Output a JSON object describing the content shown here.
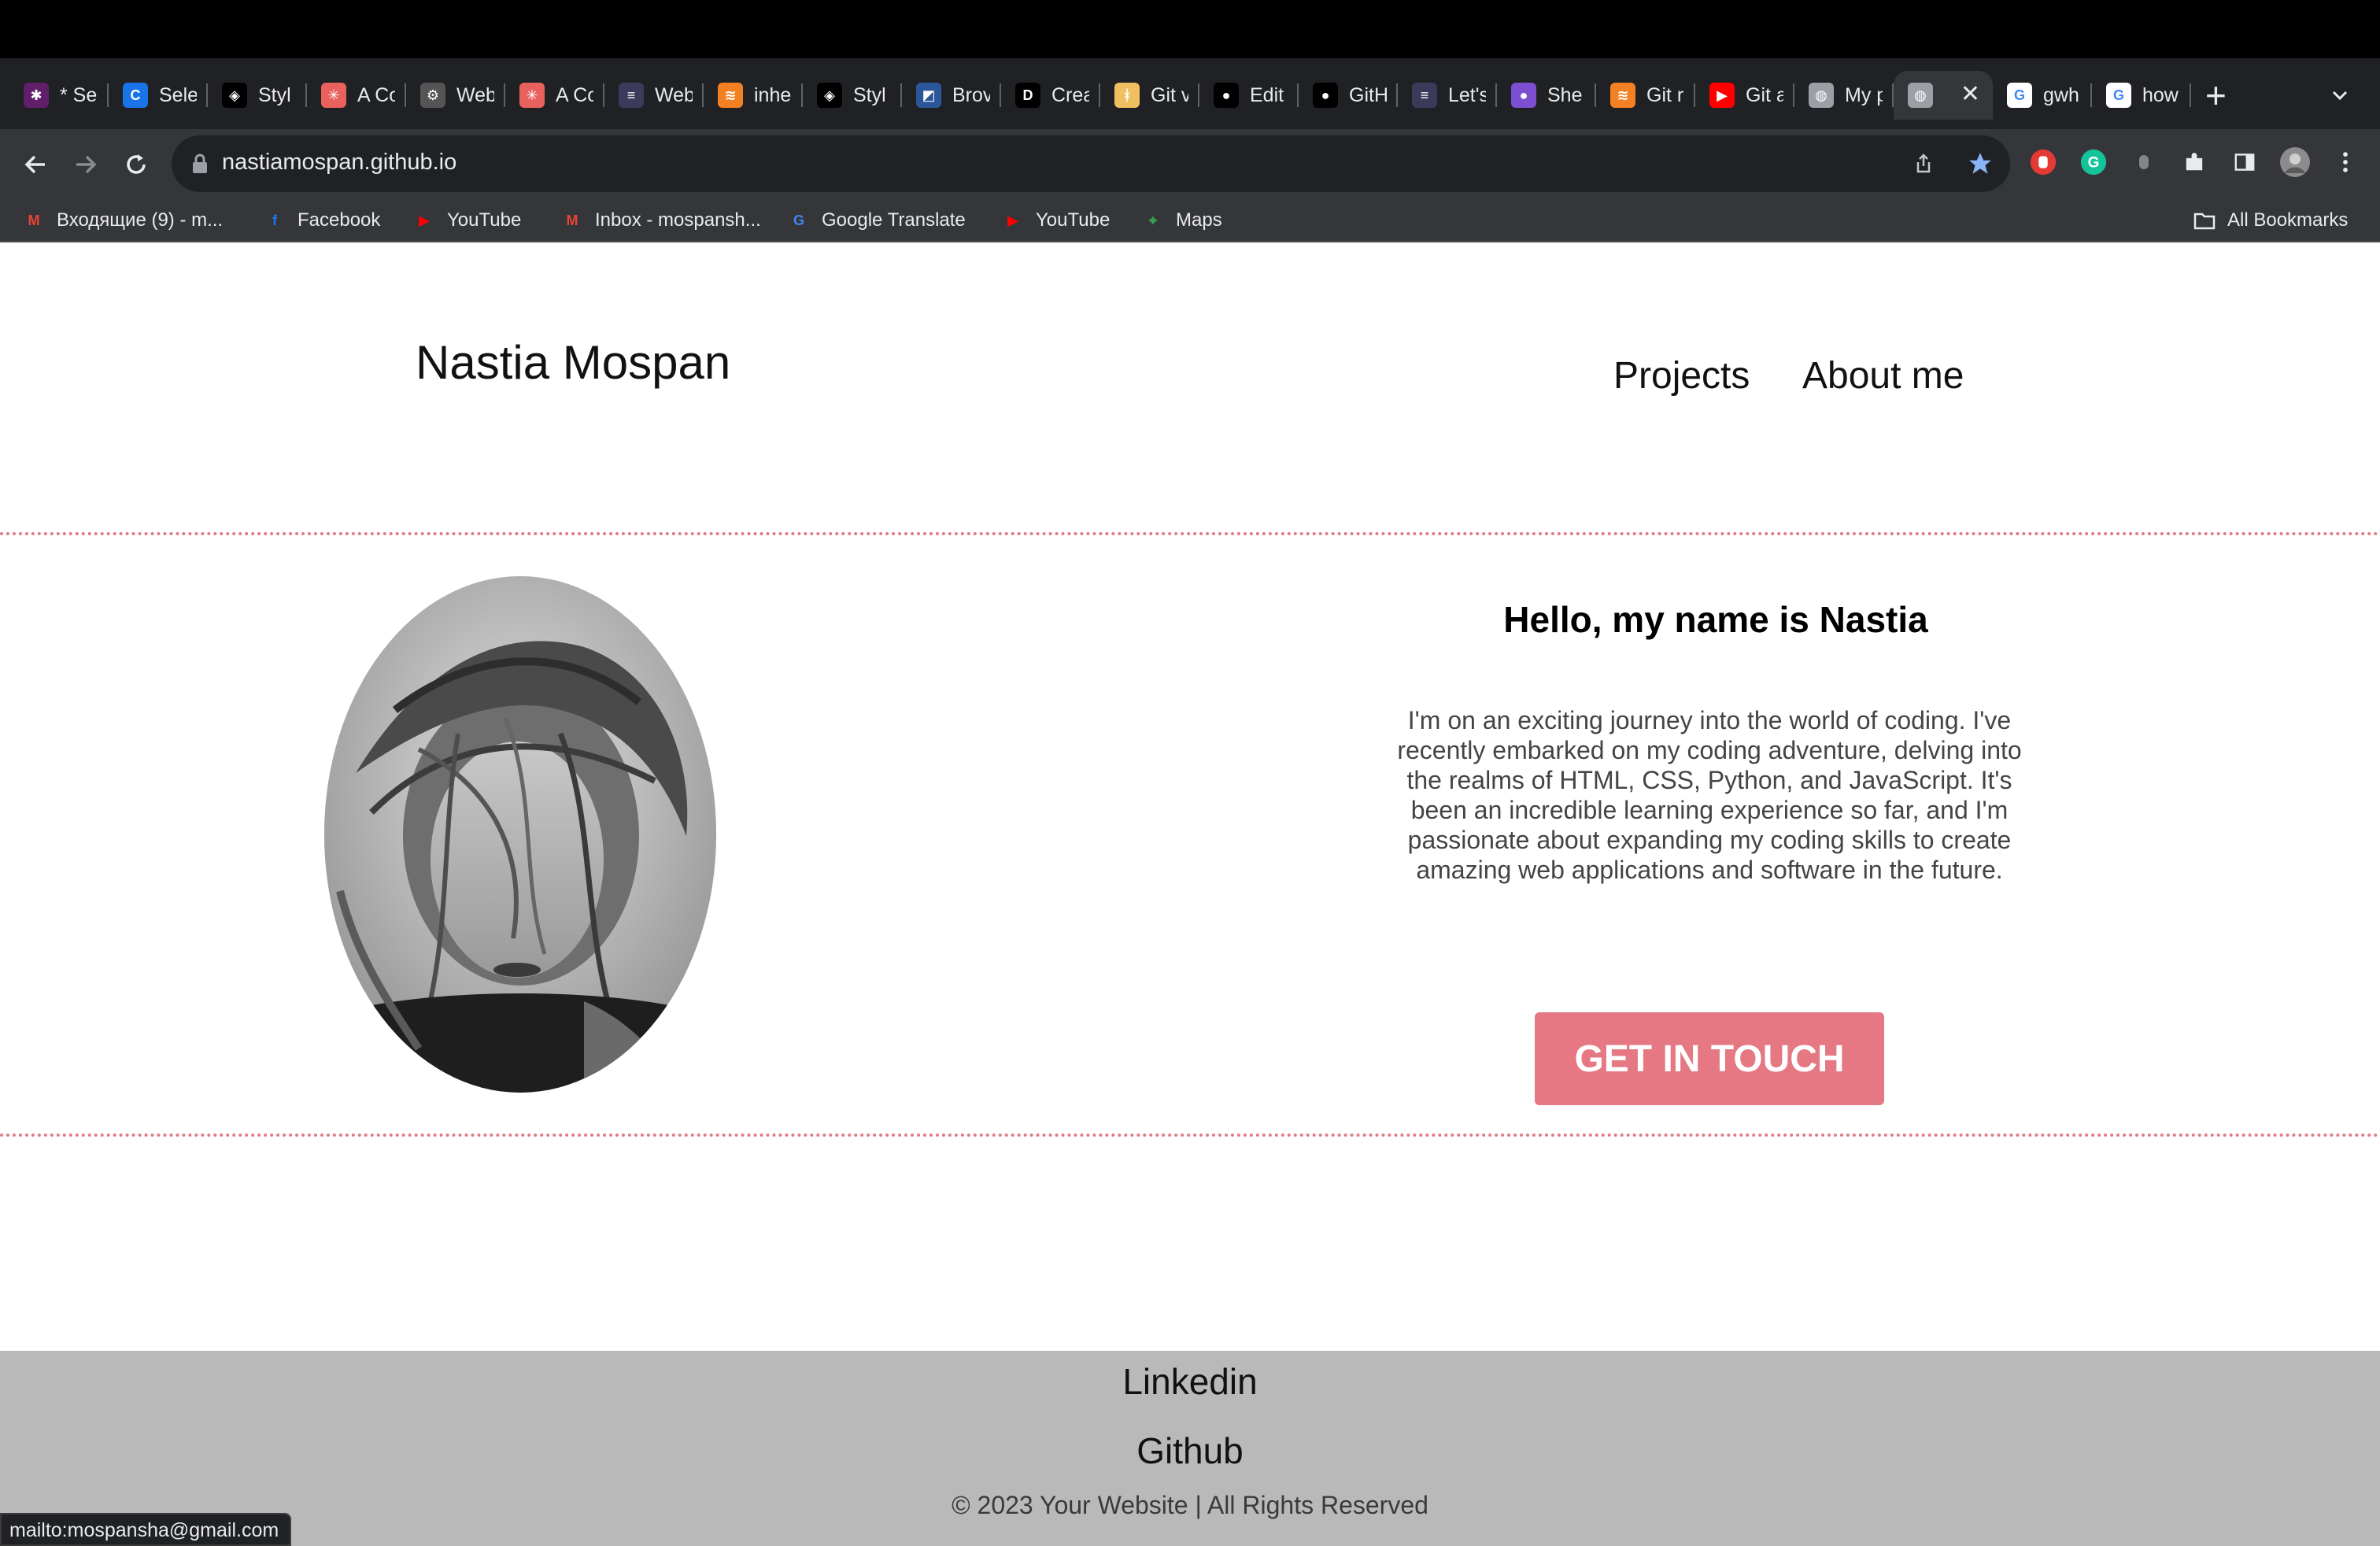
{
  "browser": {
    "tabs": [
      {
        "label": "* Se",
        "icon": "slack-icon",
        "color": "#611f69"
      },
      {
        "label": "Sele",
        "icon": "circle-c-icon",
        "color": "#1a73e8"
      },
      {
        "label": "Styl",
        "icon": "codepen-icon",
        "color": "#000000"
      },
      {
        "label": "A Co",
        "icon": "asterisk-icon",
        "color": "#e8615d"
      },
      {
        "label": "Web",
        "icon": "gear-icon",
        "color": "#555555"
      },
      {
        "label": "A Co",
        "icon": "asterisk-icon",
        "color": "#e8615d"
      },
      {
        "label": "Web",
        "icon": "bars-icon",
        "color": "#3a3a5a"
      },
      {
        "label": "inhe",
        "icon": "stackoverflow-icon",
        "color": "#f48024"
      },
      {
        "label": "Styl",
        "icon": "codepen-icon",
        "color": "#000000"
      },
      {
        "label": "Brov",
        "icon": "caniuse-icon",
        "color": "#2b579a"
      },
      {
        "label": "Crea",
        "icon": "dev-icon",
        "color": "#000000"
      },
      {
        "label": "Git v",
        "icon": "git-branch-icon",
        "color": "#f0c060"
      },
      {
        "label": "Edit",
        "icon": "github-icon",
        "color": "#000000"
      },
      {
        "label": "GitH",
        "icon": "github-icon",
        "color": "#000000"
      },
      {
        "label": "Let's",
        "icon": "bars-icon",
        "color": "#3a3a5a"
      },
      {
        "label": "She",
        "icon": "circle-purple-icon",
        "color": "#7b4fcf"
      },
      {
        "label": "Git r",
        "icon": "stackoverflow-icon",
        "color": "#f48024"
      },
      {
        "label": "Git a",
        "icon": "youtube-icon",
        "color": "#ff0000"
      },
      {
        "label": "My p",
        "icon": "globe-icon",
        "color": "#9aa0a6"
      },
      {
        "label": "",
        "icon": "globe-icon",
        "color": "#9aa0a6",
        "active": true
      },
      {
        "label": "gwh",
        "icon": "google-icon",
        "color": "#ffffff"
      },
      {
        "label": "how",
        "icon": "google-icon",
        "color": "#ffffff"
      }
    ],
    "url": "nastiamospan.github.io",
    "bookmarks": [
      {
        "label": "Входящие (9) - m...",
        "icon": "gmail-icon",
        "color": "#ea4335"
      },
      {
        "label": "Facebook",
        "icon": "facebook-icon",
        "color": "#1877f2"
      },
      {
        "label": "YouTube",
        "icon": "youtube-icon",
        "color": "#ff0000"
      },
      {
        "label": "Inbox - mospansh...",
        "icon": "gmail-icon",
        "color": "#ea4335"
      },
      {
        "label": "Google Translate",
        "icon": "translate-icon",
        "color": "#4285f4"
      },
      {
        "label": "YouTube",
        "icon": "youtube-icon",
        "color": "#ff0000"
      },
      {
        "label": "Maps",
        "icon": "maps-icon",
        "color": "#34a853"
      }
    ],
    "all_bookmarks_label": "All Bookmarks",
    "status_text": "mailto:mospansha@gmail.com"
  },
  "site": {
    "name": "Nastia Mospan",
    "nav": {
      "projects": "Projects",
      "about": "About me"
    },
    "hero": {
      "heading": "Hello, my name is Nastia",
      "intro": "I'm on an exciting journey into the world of coding. I've recently embarked on my coding adventure, delving into the realms of HTML, CSS, Python, and JavaScript. It's been an incredible learning experience so far, and I'm passionate about expanding my coding skills to create amazing web applications and software in the future.",
      "cta": "GET IN TOUCH"
    },
    "footer": {
      "linkedin": "Linkedin",
      "github": "Github",
      "copyright": "© 2023 Your Website | All Rights Reserved"
    }
  },
  "colors": {
    "accent": "#e57883",
    "divider": "#e07a85",
    "footer_bg": "#b9b9b9"
  }
}
